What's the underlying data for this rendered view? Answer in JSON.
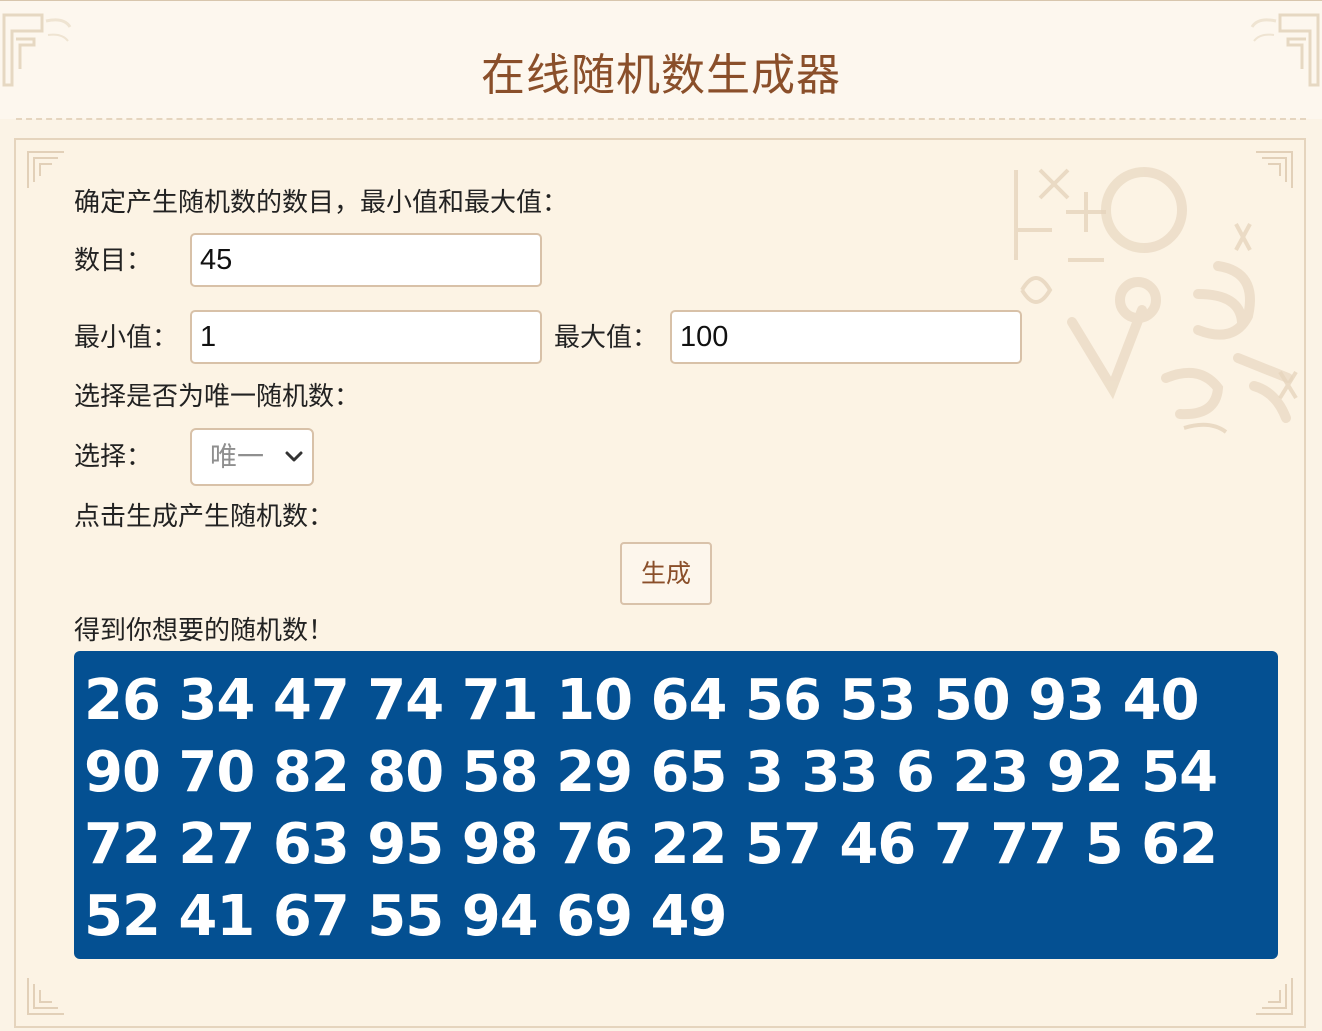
{
  "title": "在线随机数生成器",
  "intro_label": "确定产生随机数的数目，最小值和最大值：",
  "count": {
    "label": "数目：",
    "value": "45"
  },
  "range": {
    "min_label": "最小值：",
    "min_value": "1",
    "max_label": "最大值：",
    "max_value": "100"
  },
  "unique_prompt": "选择是否为唯一随机数：",
  "select": {
    "label": "选择：",
    "selected": "唯一"
  },
  "generate_prompt": "点击生成产生随机数：",
  "generate_button": "生成",
  "result_label": "得到你想要的随机数！",
  "results": "26 34 47 74 71 10 64 56 53 50 93 40 90 70 82 80 58 29 65 3 33 6 23 92 54 72 27 63 95 98 76 22 57 46 7 77 5 62 52 41 67 55 94 69 49",
  "colors": {
    "title": "#8a4f2a",
    "result_background": "#045092",
    "result_text": "#ffffff",
    "panel_background": "#fcf3e4",
    "input_border": "#d8c1a8"
  },
  "icons": {
    "select_arrow": "chevron-down-icon",
    "decoration": "math-decoration-icon"
  }
}
